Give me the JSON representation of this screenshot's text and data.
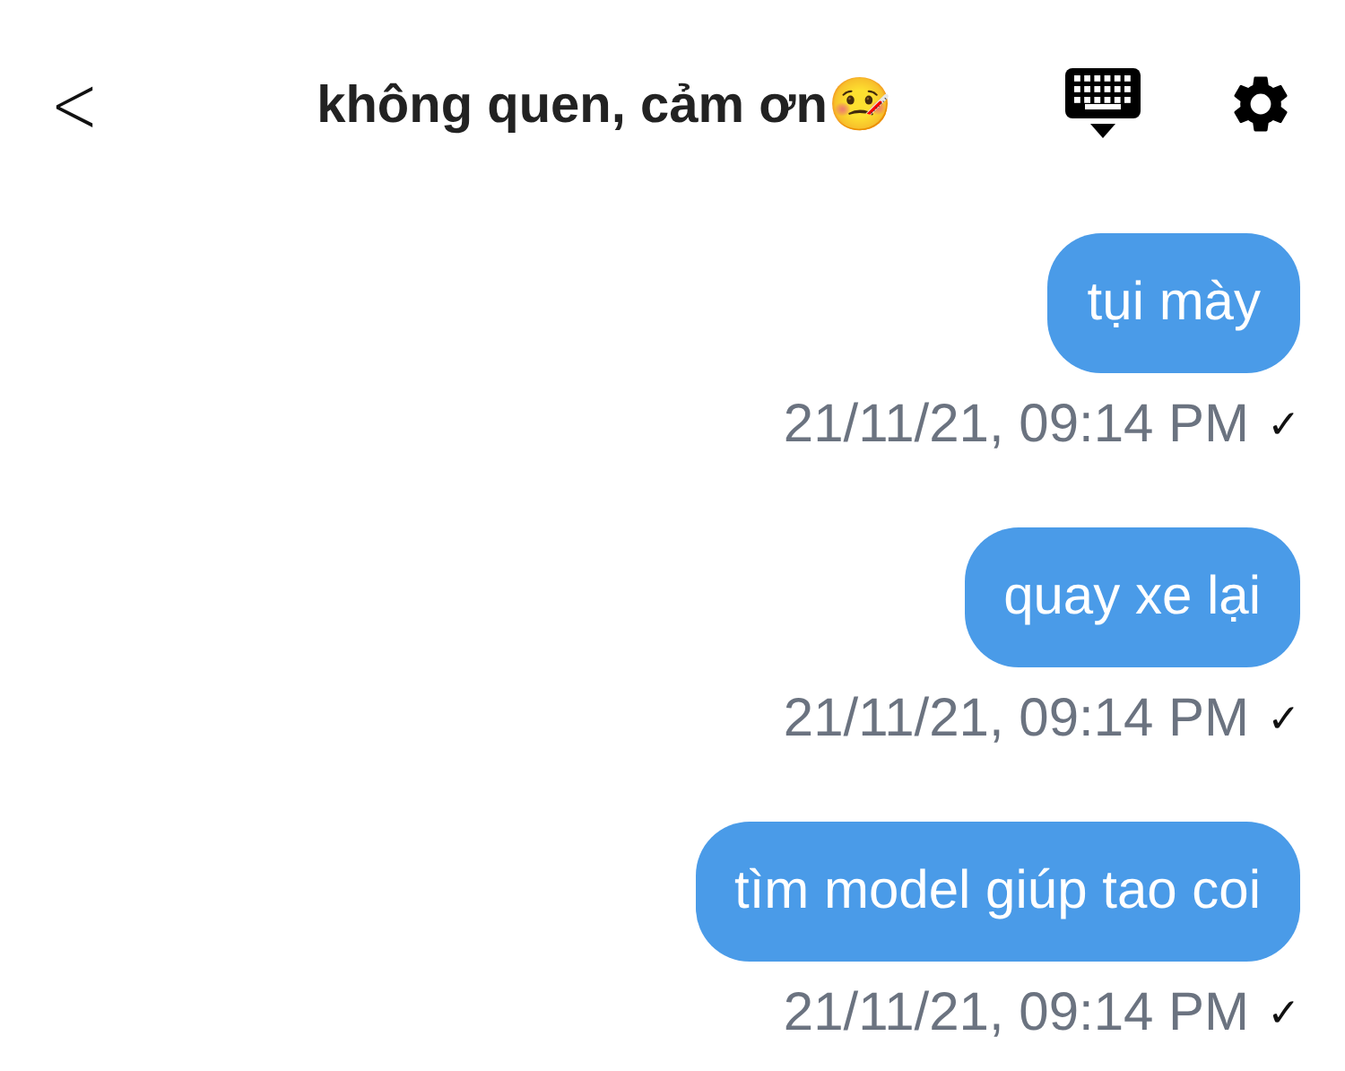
{
  "header": {
    "back": "<",
    "title": "không quen, cảm ơn🤒"
  },
  "messages": [
    {
      "text": "tụi mày",
      "time": "21/11/21, 09:14 PM",
      "check": "✓"
    },
    {
      "text": "quay xe lại",
      "time": "21/11/21, 09:14 PM",
      "check": "✓"
    },
    {
      "text": "tìm model giúp tao coi",
      "time": "21/11/21, 09:14 PM",
      "check": "✓"
    }
  ]
}
